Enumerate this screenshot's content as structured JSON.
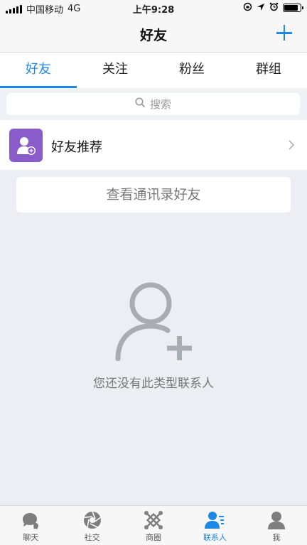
{
  "status_bar": {
    "carrier": "中国移动",
    "network": "4G",
    "time": "上午9:28",
    "battery_level": 0.85
  },
  "nav": {
    "title": "好友",
    "add_icon": "plus-icon"
  },
  "tabs": [
    {
      "label": "好友",
      "active": true
    },
    {
      "label": "关注",
      "active": false
    },
    {
      "label": "粉丝",
      "active": false
    },
    {
      "label": "群组",
      "active": false
    }
  ],
  "search": {
    "placeholder": "搜索"
  },
  "recommend": {
    "label": "好友推荐",
    "icon": "add-friend-icon"
  },
  "contacts_button": {
    "label": "查看通讯录好友"
  },
  "empty_state": {
    "text": "您还没有此类型联系人",
    "icon": "add-person-icon"
  },
  "tab_bar": [
    {
      "label": "聊天",
      "icon": "chat-icon",
      "active": false
    },
    {
      "label": "社交",
      "icon": "aperture-icon",
      "active": false
    },
    {
      "label": "商圈",
      "icon": "network-icon",
      "active": false
    },
    {
      "label": "联系人",
      "icon": "contacts-icon",
      "active": true
    },
    {
      "label": "我",
      "icon": "person-icon",
      "active": false
    }
  ],
  "colors": {
    "accent": "#1e88e5",
    "recommend_avatar": "#8a5cc9",
    "background": "#eceef3"
  }
}
